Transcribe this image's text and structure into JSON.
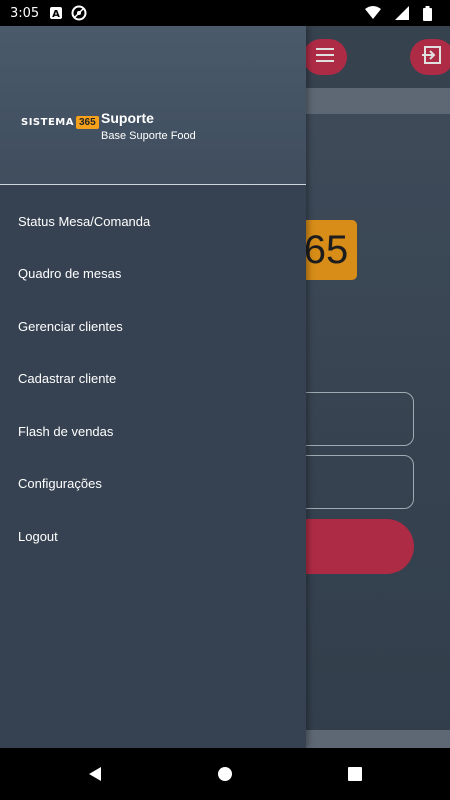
{
  "status_bar": {
    "time": "3:05",
    "icons": [
      "a-badge-icon",
      "at-sync-icon",
      "wifi-icon",
      "signal-icon",
      "battery-icon"
    ]
  },
  "drawer": {
    "brand_word": "SISTEMA",
    "brand_number": "365",
    "user_name": "Suporte",
    "user_subtitle": "Base Suporte Food",
    "menu_items": [
      {
        "label": "Status Mesa/Comanda"
      },
      {
        "label": "Quadro de mesas"
      },
      {
        "label": "Gerenciar clientes"
      },
      {
        "label": "Cadastrar cliente"
      },
      {
        "label": "Flash de vendas"
      },
      {
        "label": "Configurações"
      },
      {
        "label": "Logout"
      }
    ]
  },
  "background": {
    "logo_fragment": "65"
  },
  "colors": {
    "accent": "#c7314f",
    "brand_orange": "#f5a11c",
    "drawer_bg": "#364251"
  }
}
